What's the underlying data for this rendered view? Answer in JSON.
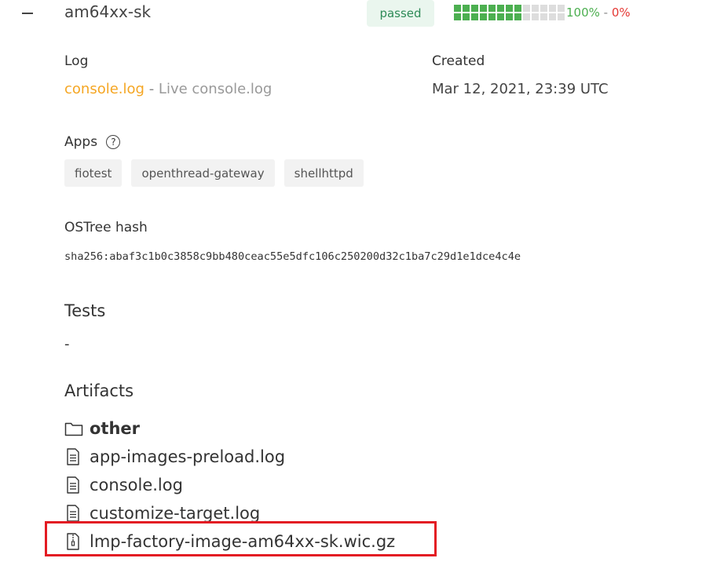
{
  "target": {
    "name": "am64xx-sk",
    "status": "passed",
    "progress": {
      "passed_cells": 16,
      "total_cells": 26,
      "passed_pct": "100%",
      "separator": "-",
      "failed_pct": "0%"
    }
  },
  "log": {
    "label": "Log",
    "console_link": "console.log",
    "separator": "-",
    "live_label": "Live console.log"
  },
  "created": {
    "label": "Created",
    "value": "Mar 12, 2021, 23:39 UTC"
  },
  "apps": {
    "label": "Apps",
    "help_glyph": "?",
    "items": [
      "fiotest",
      "openthread-gateway",
      "shellhttpd"
    ]
  },
  "ostree": {
    "label": "OSTree hash",
    "value": "sha256:abaf3c1b0c3858c9bb480ceac55e5dfc106c250200d32c1ba7c29d1e1dce4c4e"
  },
  "tests": {
    "label": "Tests",
    "value": "-"
  },
  "artifacts": {
    "label": "Artifacts",
    "folder": "other",
    "files": [
      {
        "name": "app-images-preload.log",
        "icon": "file-text-icon"
      },
      {
        "name": "console.log",
        "icon": "file-text-icon"
      },
      {
        "name": "customize-target.log",
        "icon": "file-text-icon"
      },
      {
        "name": "lmp-factory-image-am64xx-sk.wic.gz",
        "icon": "file-zip-icon"
      }
    ]
  },
  "colors": {
    "accent": "#f5a623",
    "passed": "#4caf50",
    "failed": "#e53935",
    "highlight": "#e31b23"
  }
}
